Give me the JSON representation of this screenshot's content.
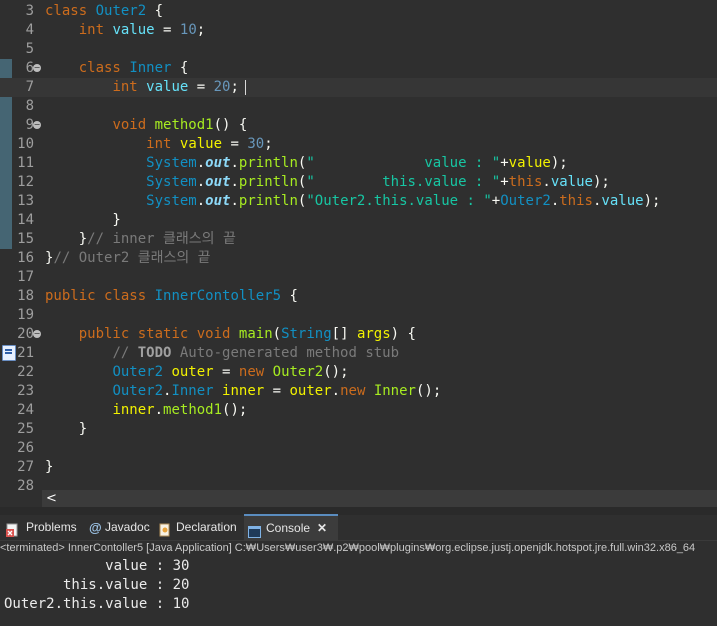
{
  "editor": {
    "lines": [
      {
        "n": "3",
        "tokens": [
          [
            "class",
            "k"
          ],
          [
            " ",
            "o"
          ],
          [
            "Outer2",
            "t"
          ],
          [
            " {",
            "o"
          ]
        ]
      },
      {
        "n": "4",
        "tokens": [
          [
            "    ",
            "o"
          ],
          [
            "int",
            "k"
          ],
          [
            " ",
            "o"
          ],
          [
            "value",
            "fv"
          ],
          [
            " = ",
            "o"
          ],
          [
            "10",
            "n"
          ],
          [
            ";",
            "o"
          ]
        ]
      },
      {
        "n": "5",
        "tokens": []
      },
      {
        "n": "6",
        "fold": true,
        "tokens": [
          [
            "    ",
            "o"
          ],
          [
            "class",
            "k"
          ],
          [
            " ",
            "o"
          ],
          [
            "Inner",
            "t"
          ],
          [
            " {",
            "o"
          ]
        ]
      },
      {
        "n": "7",
        "current": true,
        "caret": true,
        "tokens": [
          [
            "        ",
            "o"
          ],
          [
            "int",
            "k"
          ],
          [
            " ",
            "o"
          ],
          [
            "value",
            "fv"
          ],
          [
            " = ",
            "o"
          ],
          [
            "20",
            "n"
          ],
          [
            ";",
            "o"
          ]
        ]
      },
      {
        "n": "8",
        "tokens": []
      },
      {
        "n": "9",
        "fold": true,
        "tokens": [
          [
            "        ",
            "o"
          ],
          [
            "void",
            "k"
          ],
          [
            " ",
            "o"
          ],
          [
            "method1",
            "m"
          ],
          [
            "() {",
            "o"
          ]
        ]
      },
      {
        "n": "10",
        "tokens": [
          [
            "            ",
            "o"
          ],
          [
            "int",
            "k"
          ],
          [
            " ",
            "o"
          ],
          [
            "value",
            "v"
          ],
          [
            " = ",
            "o"
          ],
          [
            "30",
            "n"
          ],
          [
            ";",
            "o"
          ]
        ]
      },
      {
        "n": "11",
        "tokens": [
          [
            "            ",
            "o"
          ],
          [
            "System",
            "ty"
          ],
          [
            ".",
            "o"
          ],
          [
            "out",
            "out"
          ],
          [
            ".",
            "o"
          ],
          [
            "println",
            "m"
          ],
          [
            "(",
            "o"
          ],
          [
            "\"             value : \"",
            "s"
          ],
          [
            "+",
            "o"
          ],
          [
            "value",
            "v"
          ],
          [
            ");",
            "o"
          ]
        ]
      },
      {
        "n": "12",
        "tokens": [
          [
            "            ",
            "o"
          ],
          [
            "System",
            "ty"
          ],
          [
            ".",
            "o"
          ],
          [
            "out",
            "out"
          ],
          [
            ".",
            "o"
          ],
          [
            "println",
            "m"
          ],
          [
            "(",
            "o"
          ],
          [
            "\"        this.value : \"",
            "s"
          ],
          [
            "+",
            "o"
          ],
          [
            "this",
            "k"
          ],
          [
            ".",
            "o"
          ],
          [
            "value",
            "fv"
          ],
          [
            ");",
            "o"
          ]
        ]
      },
      {
        "n": "13",
        "tokens": [
          [
            "            ",
            "o"
          ],
          [
            "System",
            "ty"
          ],
          [
            ".",
            "o"
          ],
          [
            "out",
            "out"
          ],
          [
            ".",
            "o"
          ],
          [
            "println",
            "m"
          ],
          [
            "(",
            "o"
          ],
          [
            "\"Outer2.this.value : \"",
            "s"
          ],
          [
            "+",
            "o"
          ],
          [
            "Outer2",
            "ty"
          ],
          [
            ".",
            "o"
          ],
          [
            "this",
            "k"
          ],
          [
            ".",
            "o"
          ],
          [
            "value",
            "fv"
          ],
          [
            ");",
            "o"
          ]
        ]
      },
      {
        "n": "14",
        "tokens": [
          [
            "        }",
            "o"
          ]
        ]
      },
      {
        "n": "15",
        "tokens": [
          [
            "    }",
            "o"
          ],
          [
            "// inner 클래스의 끝",
            "c"
          ]
        ]
      },
      {
        "n": "16",
        "tokens": [
          [
            "}",
            "o"
          ],
          [
            "// Outer2 클래스의 끝",
            "c"
          ]
        ]
      },
      {
        "n": "17",
        "tokens": []
      },
      {
        "n": "18",
        "tokens": [
          [
            "public",
            "k"
          ],
          [
            " ",
            "o"
          ],
          [
            "class",
            "k"
          ],
          [
            " ",
            "o"
          ],
          [
            "InnerContoller5",
            "t"
          ],
          [
            " {",
            "o"
          ]
        ]
      },
      {
        "n": "19",
        "tokens": []
      },
      {
        "n": "20",
        "fold": true,
        "tokens": [
          [
            "    ",
            "o"
          ],
          [
            "public",
            "k"
          ],
          [
            " ",
            "o"
          ],
          [
            "static",
            "k"
          ],
          [
            " ",
            "o"
          ],
          [
            "void",
            "k"
          ],
          [
            " ",
            "o"
          ],
          [
            "main",
            "m"
          ],
          [
            "(",
            "o"
          ],
          [
            "String",
            "ty"
          ],
          [
            "[] ",
            "o"
          ],
          [
            "args",
            "v"
          ],
          [
            ") {",
            "o"
          ]
        ]
      },
      {
        "n": "21",
        "warn": true,
        "tokens": [
          [
            "        ",
            "o"
          ],
          [
            "// ",
            "c"
          ],
          [
            "TODO",
            "todo"
          ],
          [
            " Auto-generated method stub",
            "c"
          ]
        ]
      },
      {
        "n": "22",
        "tokens": [
          [
            "        ",
            "o"
          ],
          [
            "Outer2",
            "ty"
          ],
          [
            " ",
            "o"
          ],
          [
            "outer",
            "v"
          ],
          [
            " = ",
            "o"
          ],
          [
            "new",
            "k"
          ],
          [
            " ",
            "o"
          ],
          [
            "Outer2",
            "m"
          ],
          [
            "();",
            "o"
          ]
        ]
      },
      {
        "n": "23",
        "tokens": [
          [
            "        ",
            "o"
          ],
          [
            "Outer2",
            "ty"
          ],
          [
            ".",
            "o"
          ],
          [
            "Inner",
            "ty"
          ],
          [
            " ",
            "o"
          ],
          [
            "inner",
            "v"
          ],
          [
            " = ",
            "o"
          ],
          [
            "outer",
            "v"
          ],
          [
            ".",
            "o"
          ],
          [
            "new",
            "k"
          ],
          [
            " ",
            "o"
          ],
          [
            "Inner",
            "m"
          ],
          [
            "();",
            "o"
          ]
        ]
      },
      {
        "n": "24",
        "tokens": [
          [
            "        ",
            "o"
          ],
          [
            "inner",
            "v"
          ],
          [
            ".",
            "o"
          ],
          [
            "method1",
            "m"
          ],
          [
            "();",
            "o"
          ]
        ]
      },
      {
        "n": "25",
        "tokens": [
          [
            "    }",
            "o"
          ]
        ]
      },
      {
        "n": "26",
        "tokens": []
      },
      {
        "n": "27",
        "tokens": [
          [
            "}",
            "o"
          ]
        ]
      },
      {
        "n": "28",
        "tokens": []
      }
    ]
  },
  "scroll": {
    "left_arrow": "<"
  },
  "tabs": [
    {
      "label": "Problems",
      "icon": "problems-icon",
      "icon_color": "#d9534f"
    },
    {
      "label": "Javadoc",
      "icon": "javadoc-icon",
      "icon_color": "#9ec5e8",
      "glyph": "@"
    },
    {
      "label": "Declaration",
      "icon": "declaration-icon",
      "icon_color": "#e8c48a"
    },
    {
      "label": "Console",
      "icon": "console-icon",
      "icon_color": "#7fb2e5",
      "active": true,
      "close": "✕"
    }
  ],
  "status": "<terminated> InnerContoller5 [Java Application] C:₩Users₩user3₩.p2₩pool₩plugins₩org.eclipse.justj.openjdk.hotspot.jre.full.win32.x86_64",
  "console": [
    "            value : 30",
    "       this.value : 20",
    "Outer2.this.value : 10"
  ],
  "colors": {
    "background": "#2f2f2f",
    "gutter_change_marker": "#456573",
    "active_tab_accent": "#5a8cbf"
  }
}
